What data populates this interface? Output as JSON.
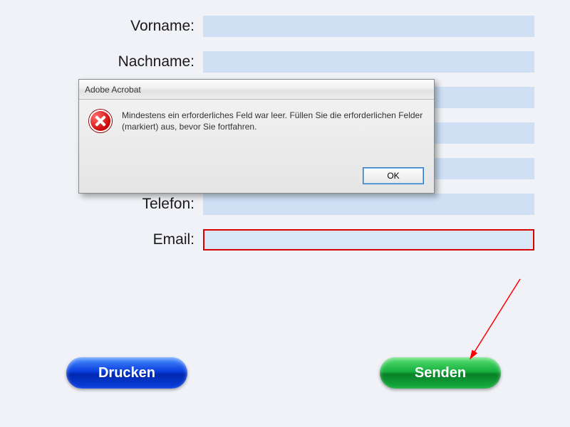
{
  "form": {
    "vorname_label": "Vorname:",
    "nachname_label": "Nachname:",
    "telefon_label": "Telefon:",
    "email_label": "Email:",
    "vorname_value": "",
    "nachname_value": "",
    "field3_value": "",
    "field4_value": "",
    "field5_value": "",
    "telefon_value": "",
    "email_value": ""
  },
  "buttons": {
    "print_label": "Drucken",
    "send_label": "Senden"
  },
  "dialog": {
    "title": "Adobe Acrobat",
    "message": "Mindestens ein erforderliches Feld war leer. Füllen Sie die erforderlichen Felder (markiert) aus, bevor Sie fortfahren.",
    "ok_label": "OK"
  }
}
